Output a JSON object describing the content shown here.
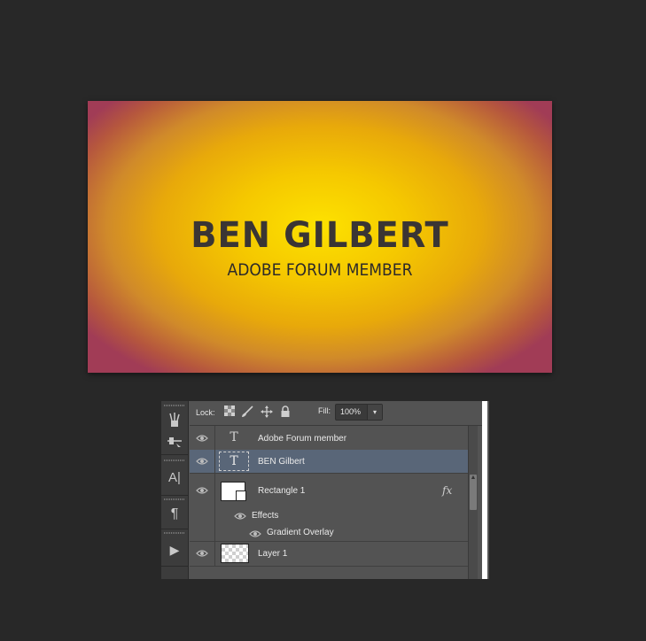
{
  "canvas": {
    "name_text": "BEN GILBERT",
    "subtitle_text": "ADOBE FORUM MEMBER"
  },
  "layers_panel": {
    "lock_label": "Lock:",
    "lock_icons": [
      "lock-transparent-pixels-icon",
      "lock-image-pixels-icon",
      "lock-position-icon",
      "lock-all-icon"
    ],
    "fill_label": "Fill:",
    "fill_value": "100%",
    "layers": [
      {
        "name": "Adobe Forum member",
        "type": "text",
        "selected": false
      },
      {
        "name": "BEN Gilbert",
        "type": "text",
        "selected": true
      },
      {
        "name": "Rectangle 1",
        "type": "shape",
        "selected": false,
        "has_fx": true,
        "fx_label": "fx"
      },
      {
        "name": "Layer 1",
        "type": "raster",
        "selected": false
      }
    ],
    "effects_label": "Effects",
    "effect_items": [
      "Gradient Overlay"
    ]
  },
  "tool_strip": {
    "icons": [
      "brush-presets-icon",
      "brush-settings-icon",
      "character-icon",
      "paragraph-icon",
      "play-action-icon"
    ],
    "character_glyph": "A|",
    "paragraph_glyph": "¶",
    "play_glyph": "▶"
  },
  "colors": {
    "app_background": "#282828",
    "panel_background": "#535353",
    "selected_row": "#596678",
    "gradient_center": "#fde200",
    "gradient_edge": "#a13c56",
    "card_text": "#3a3534"
  }
}
